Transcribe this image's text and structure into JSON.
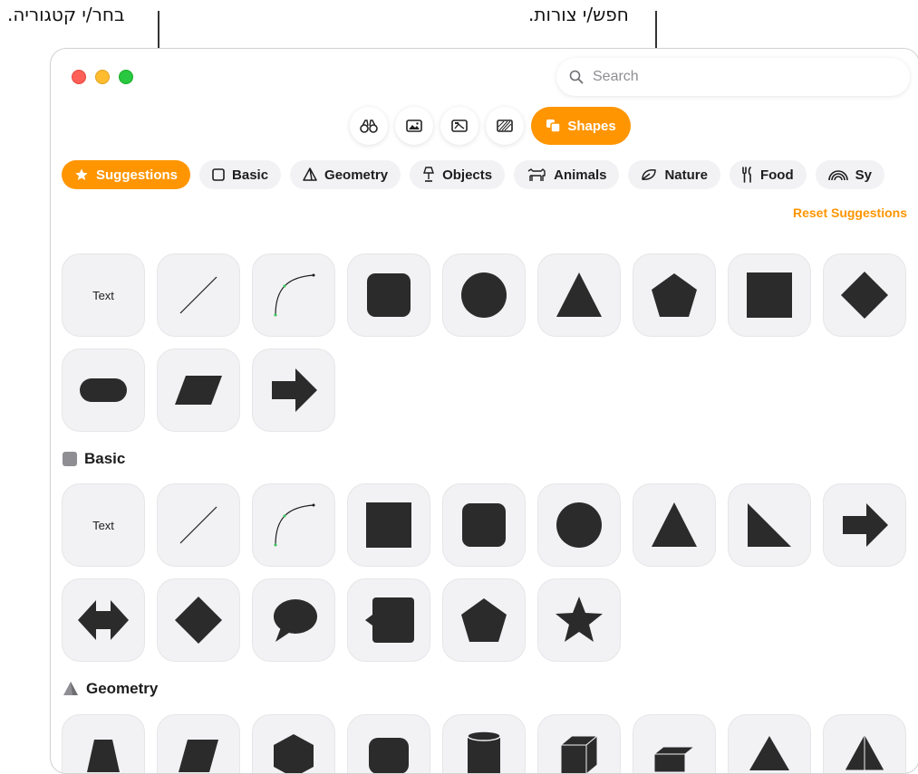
{
  "callouts": {
    "category": "בחר/י קטגוריה.",
    "search": "חפש/י צורות."
  },
  "search": {
    "placeholder": "Search"
  },
  "modes": [
    {
      "icon": "binoculars-icon"
    },
    {
      "icon": "photo-icon"
    },
    {
      "icon": "image-with-text-icon"
    },
    {
      "icon": "pattern-icon"
    },
    {
      "icon": "shapes-icon",
      "label": "Shapes"
    }
  ],
  "categories": [
    {
      "icon": "star-icon",
      "label": "Suggestions"
    },
    {
      "icon": "square-icon",
      "label": "Basic"
    },
    {
      "icon": "pyramid-icon",
      "label": "Geometry"
    },
    {
      "icon": "lamp-icon",
      "label": "Objects"
    },
    {
      "icon": "dog-icon",
      "label": "Animals"
    },
    {
      "icon": "leaf-icon",
      "label": "Nature"
    },
    {
      "icon": "fork-knife-icon",
      "label": "Food"
    },
    {
      "icon": "rainbow-icon",
      "label": "Sy"
    }
  ],
  "reset_label": "Reset Suggestions",
  "suggestions": [
    "text",
    "line",
    "curve",
    "rounded-square",
    "circle",
    "triangle",
    "pentagon",
    "square",
    "diamond",
    "pill",
    "parallelogram",
    "arrow"
  ],
  "text_tile_label": "Text",
  "sections": {
    "basic": {
      "title": "Basic",
      "items": [
        "text",
        "line",
        "curve",
        "square",
        "rounded-square",
        "circle",
        "triangle",
        "right-triangle",
        "arrow",
        "double-arrow",
        "diamond",
        "speech-bubble",
        "callout-square",
        "pentagon",
        "star"
      ]
    },
    "geometry": {
      "title": "Geometry"
    }
  },
  "colors": {
    "accent": "#ff9500",
    "shape": "#2b2b2b",
    "tile": "#f2f2f4"
  }
}
